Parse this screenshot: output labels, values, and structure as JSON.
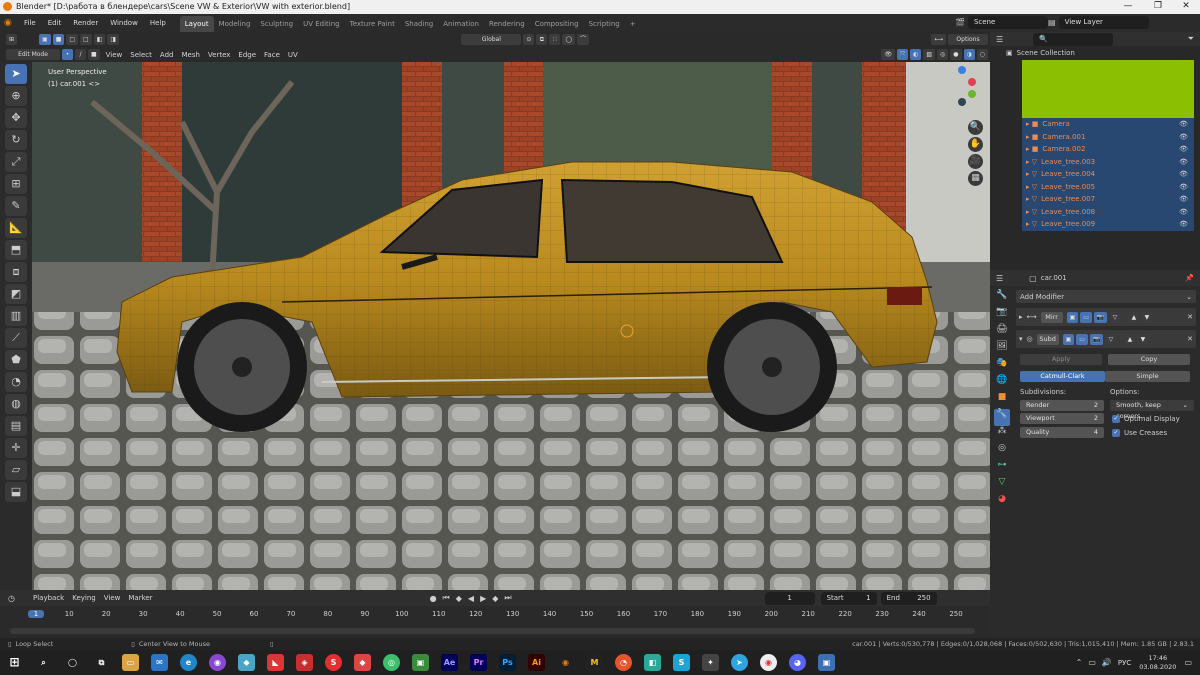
{
  "window": {
    "title": "Blender* [D:\\работа в блендере\\cars\\Scene VW & Exterior\\VW with exterior.blend]",
    "minimize": "—",
    "maximize": "❐",
    "close": "✕"
  },
  "menubar": {
    "items": [
      "File",
      "Edit",
      "Render",
      "Window",
      "Help"
    ],
    "workspaces": [
      "Layout",
      "Modeling",
      "Sculpting",
      "UV Editing",
      "Texture Paint",
      "Shading",
      "Animation",
      "Rendering",
      "Compositing",
      "Scripting"
    ],
    "active_workspace": "Layout",
    "add_workspace": "+",
    "scene": "Scene",
    "view_layer": "View Layer"
  },
  "viewport_header": {
    "mode": "Edit Mode",
    "menus": [
      "View",
      "Select",
      "Add",
      "Mesh",
      "Vertex",
      "Edge",
      "Face",
      "UV"
    ],
    "transform_orientation": "Global",
    "options": "Options"
  },
  "viewport": {
    "overlay_title": "User Perspective",
    "overlay_object": "(1) car.001 <>"
  },
  "toolbar": {
    "tools": [
      "select-icon",
      "cursor-icon",
      "move-icon",
      "rotate-icon",
      "scale-icon",
      "transform-icon",
      "annotate-icon",
      "measure-icon",
      "extrude-icon",
      "inset-icon",
      "bevel-icon",
      "loop-cut-icon",
      "knife-icon",
      "poly-build-icon",
      "spin-icon",
      "smooth-icon",
      "edge-slide-icon",
      "shrink-icon",
      "shear-icon",
      "rip-icon"
    ]
  },
  "outliner": {
    "title": "Scene Collection",
    "items": [
      "Camera",
      "Camera.001",
      "Camera.002",
      "Leave_tree.003",
      "Leave_tree.004",
      "Leave_tree.005",
      "Leave_tree.007",
      "Leave_tree.008",
      "Leave_tree.009"
    ],
    "accent": "#8ac001"
  },
  "properties": {
    "object_name": "car.001",
    "add_modifier": "Add Modifier",
    "modifier1_name": "Mirr",
    "modifier2_name": "Subd",
    "apply": "Apply",
    "copy": "Copy",
    "catmull_clark": "Catmull-Clark",
    "simple": "Simple",
    "subdivisions_label": "Subdivisions:",
    "options_label": "Options:",
    "render_label": "Render",
    "render_value": "2",
    "viewport_label": "Viewport",
    "viewport_value": "2",
    "quality_label": "Quality",
    "quality_value": "4",
    "uv_smooth": "Smooth, keep corners",
    "optimal_display": "Optimal Display",
    "use_creases": "Use Creases"
  },
  "timeline": {
    "menus": [
      "Playback",
      "Keying",
      "View",
      "Marker"
    ],
    "current_frame": "1",
    "start_label": "Start",
    "start": "1",
    "end_label": "End",
    "end": "250",
    "ticks": [
      "1",
      "10",
      "20",
      "30",
      "40",
      "50",
      "60",
      "70",
      "80",
      "90",
      "100",
      "110",
      "120",
      "130",
      "140",
      "150",
      "160",
      "170",
      "180",
      "190",
      "200",
      "210",
      "220",
      "230",
      "240",
      "250"
    ]
  },
  "statusbar": {
    "left1": "Loop Select",
    "left2": "Center View to Mouse",
    "stats": "car.001 | Verts:0/530,778 | Edges:0/1,028,068 | Faces:0/502,630 | Tris:1,015,410 | Mem: 1.85 GB | 2.83.1"
  },
  "taskbar": {
    "lang": "РУС",
    "time": "17:46",
    "date": "03.08.2020"
  }
}
